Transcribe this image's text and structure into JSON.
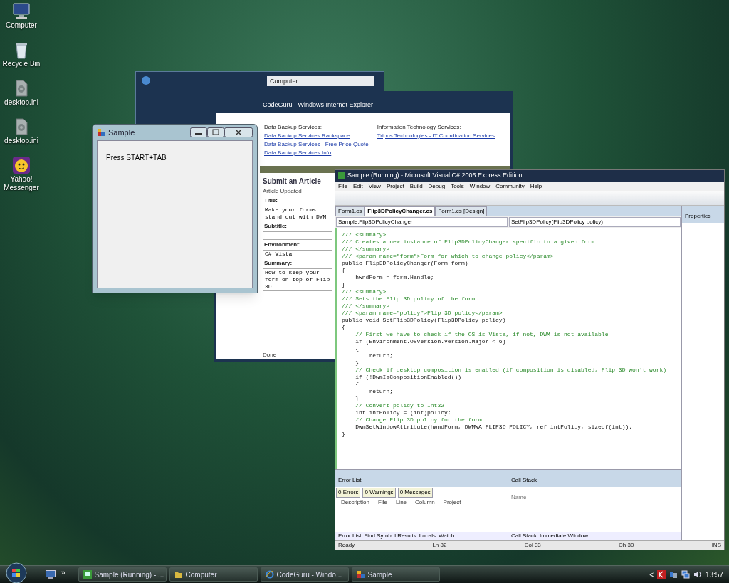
{
  "desktop_icons": [
    {
      "label": "Computer",
      "kind": "computer"
    },
    {
      "label": "Recycle Bin",
      "kind": "bin"
    },
    {
      "label": "desktop.ini",
      "kind": "file"
    },
    {
      "label": "desktop.ini",
      "kind": "file"
    },
    {
      "label": "Yahoo! Messenger",
      "kind": "messenger"
    }
  ],
  "explorer_window": {
    "address": "Computer"
  },
  "browser_window": {
    "title": "CodeGuru - Windows Internet Explorer",
    "left_heading": "Data Backup Services:",
    "left_links": [
      "Data Backup Services Rackspace",
      "Data Backup Services - Free Price Quote",
      "Data Backup Services Info"
    ],
    "right_heading": "Information Technology Services:",
    "right_links": [
      "Tripos Technologies - IT Coordination Services"
    ],
    "page_title": "Submit an Article",
    "page_subtitle": "Article Updated",
    "fields": [
      {
        "label": "Title:",
        "value": "Make your forms stand out with DWM"
      },
      {
        "label": "Subtitle:"
      },
      {
        "label": "Environment:",
        "value": "C# Vista"
      },
      {
        "label": "Summary:",
        "value": "How to keep your form on top of Flip 3D."
      }
    ],
    "status": "Done"
  },
  "sample_window": {
    "title": "Sample",
    "text": "Press START+TAB"
  },
  "vs_window": {
    "title": "Sample (Running) - Microsoft Visual C# 2005 Express Edition",
    "menu": [
      "File",
      "Edit",
      "View",
      "Project",
      "Build",
      "Debug",
      "Tools",
      "Window",
      "Community",
      "Help"
    ],
    "tabs": [
      {
        "label": "Form1.cs",
        "selected": false
      },
      {
        "label": "Flip3DPolicyChanger.cs",
        "selected": true
      },
      {
        "label": "Form1.cs [Design]",
        "selected": false
      }
    ],
    "class_dropdown": "Sample.Flip3DPolicyChanger",
    "member_dropdown": "SetFlip3DPolicy(Flip3DPolicy policy)",
    "code": [
      {
        "kind": "comment",
        "text": "/// <summary>"
      },
      {
        "kind": "comment",
        "text": "/// Creates a new instance of Flip3DPolicyChanger specific to a given form"
      },
      {
        "kind": "comment",
        "text": "/// </summary>"
      },
      {
        "kind": "comment",
        "text": "/// <param name=\"form\">Form for which to change policy</param>"
      },
      {
        "kind": "code",
        "text": "public Flip3DPolicyChanger(Form form)"
      },
      {
        "kind": "code",
        "text": "{"
      },
      {
        "kind": "code",
        "text": "    hwndForm = form.Handle;"
      },
      {
        "kind": "code",
        "text": "}"
      },
      {
        "kind": "comment",
        "text": "/// <summary>"
      },
      {
        "kind": "comment",
        "text": "/// Sets the Flip 3D policy of the form"
      },
      {
        "kind": "comment",
        "text": "/// </summary>"
      },
      {
        "kind": "comment",
        "text": "/// <param name=\"policy\">Flip 3D policy</param>"
      },
      {
        "kind": "code",
        "text": "public void SetFlip3DPolicy(Flip3DPolicy policy)"
      },
      {
        "kind": "code",
        "text": "{"
      },
      {
        "kind": "comment",
        "text": "    // First we have to check if the OS is Vista, if not, DWM is not available"
      },
      {
        "kind": "code",
        "text": "    if (Environment.OSVersion.Version.Major < 6)"
      },
      {
        "kind": "code",
        "text": "    {"
      },
      {
        "kind": "code",
        "text": "        return;"
      },
      {
        "kind": "code",
        "text": "    }"
      },
      {
        "kind": "comment",
        "text": "    // Check if desktop composition is enabled (if composition is disabled, Flip 3D won't work)"
      },
      {
        "kind": "code",
        "text": "    if (!DwmIsCompositionEnabled())"
      },
      {
        "kind": "code",
        "text": "    {"
      },
      {
        "kind": "code",
        "text": "        return;"
      },
      {
        "kind": "code",
        "text": "    }"
      },
      {
        "kind": "comment",
        "text": "    // Convert policy to Int32"
      },
      {
        "kind": "code",
        "text": "    int intPolicy = (int)policy;"
      },
      {
        "kind": "comment",
        "text": "    // Change Flip 3D policy for the form"
      },
      {
        "kind": "code",
        "text": "    DwmSetWindowAttribute(hwndForm, DWMWA_FLIP3D_POLICY, ref intPolicy, sizeof(int));"
      },
      {
        "kind": "code",
        "text": "}"
      }
    ],
    "properties_title": "Properties",
    "error_list": {
      "title": "Error List",
      "filters": [
        "0 Errors",
        "0 Warnings",
        "0 Messages"
      ],
      "columns": [
        "Description",
        "File",
        "Line",
        "Column",
        "Project"
      ]
    },
    "call_stack": {
      "title": "Call Stack",
      "column": "Name"
    },
    "bottom_tabs_left": [
      "Error List",
      "Find Symbol Results",
      "Locals",
      "Watch"
    ],
    "bottom_tabs_right": [
      "Call Stack",
      "Immediate Window"
    ],
    "status": [
      "Ready",
      "Ln 82",
      "Col 33",
      "Ch 30",
      "INS"
    ]
  },
  "taskbar": {
    "buttons": [
      {
        "label": "Sample (Running) - ...",
        "kind": "vs"
      },
      {
        "label": "Computer",
        "kind": "folder"
      },
      {
        "label": "CodeGuru - Windo...",
        "kind": "ie"
      },
      {
        "label": "Sample",
        "kind": "app"
      }
    ],
    "overflow": "»",
    "tray_expand": "<",
    "clock": "13:57"
  }
}
